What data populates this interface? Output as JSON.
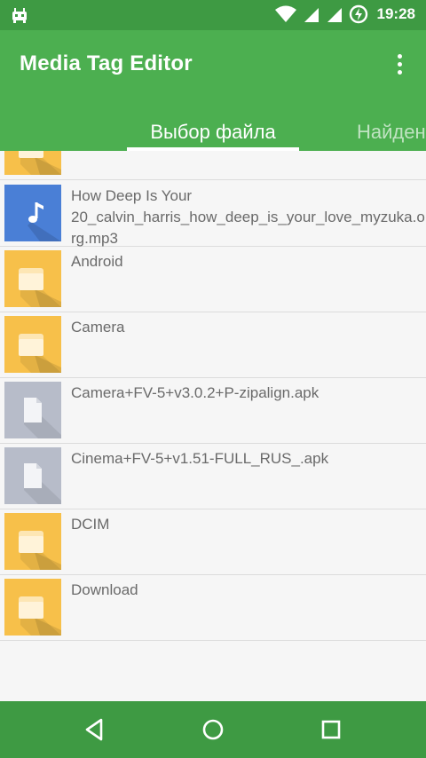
{
  "status_bar": {
    "time": "19:28",
    "icons": [
      "android-debug-icon",
      "wifi-icon",
      "signal-icon",
      "signal-icon",
      "battery-charging-icon"
    ]
  },
  "app_bar": {
    "title": "Media Tag Editor",
    "menu_icon": "overflow-menu-icon"
  },
  "tabs": [
    {
      "label": "Выбор файла",
      "active": true
    },
    {
      "label": "Найден",
      "active": false
    }
  ],
  "file_list": [
    {
      "type": "folder",
      "name": ""
    },
    {
      "type": "audio",
      "name": "How Deep Is Your\n20_calvin_harris_how_deep_is_your_love_myzuka.org.mp3"
    },
    {
      "type": "folder",
      "name": "Android"
    },
    {
      "type": "folder",
      "name": "Camera"
    },
    {
      "type": "file",
      "name": "Camera+FV-5+v3.0.2+P-zipalign.apk"
    },
    {
      "type": "file",
      "name": "Cinema+FV-5+v1.51-FULL_RUS_.apk"
    },
    {
      "type": "folder",
      "name": "DCIM"
    },
    {
      "type": "folder",
      "name": "Download"
    }
  ],
  "nav_bar": {
    "icons": [
      "back-icon",
      "home-icon",
      "recents-icon"
    ]
  },
  "colors": {
    "status_bar": "#3e9a43",
    "app_bar": "#4caf50",
    "folder": "#f7c04a",
    "audio": "#4a7fd6",
    "file": "#b7bcc9"
  }
}
